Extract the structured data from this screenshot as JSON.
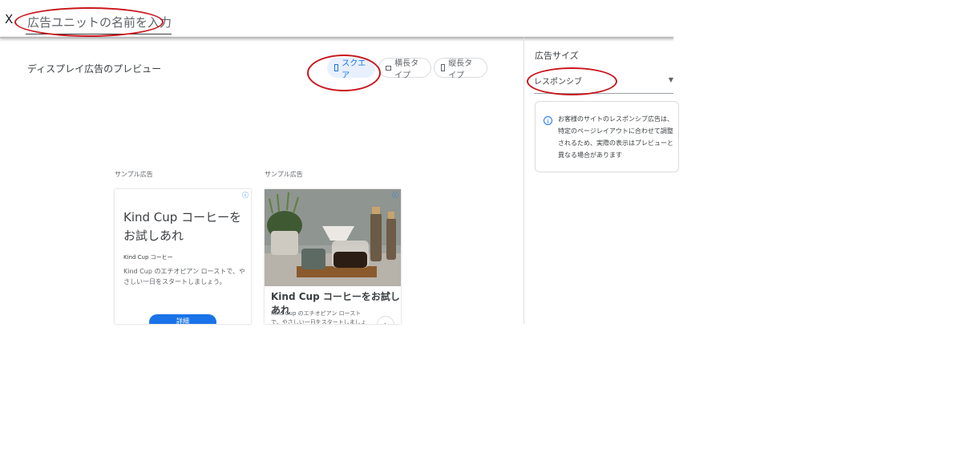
{
  "topbar": {
    "close_label": "X",
    "name_placeholder": "広告ユニットの名前を入力"
  },
  "preview": {
    "title": "ディスプレイ広告のプレビュー",
    "formats": [
      {
        "label": "スクエア",
        "icon": "square-format-icon",
        "active": true
      },
      {
        "label": "横長タイプ",
        "icon": "horizontal-format-icon",
        "active": false
      },
      {
        "label": "縦長タイプ",
        "icon": "vertical-format-icon",
        "active": false
      }
    ],
    "ads": [
      {
        "label": "サンプル広告",
        "headline": "Kind Cup コーヒーをお試しあれ",
        "brand": "Kind Cup コーヒー",
        "description": "Kind Cup のエチオピアン ローストで、やさしい一日をスタートしましょう。",
        "cta": "詳細",
        "adchoice_icon": "adchoices-icon"
      },
      {
        "label": "サンプル広告",
        "headline": "Kind Cup コーヒーをお試しあれ",
        "description": "Kind Cup のエチオピアン ローストで、やさしい一日をスタートしましょう。",
        "next_icon": "chevron-right-icon",
        "adchoice_icon": "adchoices-icon"
      }
    ]
  },
  "side_panel": {
    "title": "広告サイズ",
    "selected_size": "レスポンシブ",
    "info_icon": "info-icon",
    "info_text": "お客様のサイトのレスポンシブ広告は、特定のページレイアウトに合わせて調整されるため、実際の表示はプレビューと異なる場合があります"
  },
  "colors": {
    "accent": "#1a73e8",
    "annotation": "#c8161d"
  }
}
